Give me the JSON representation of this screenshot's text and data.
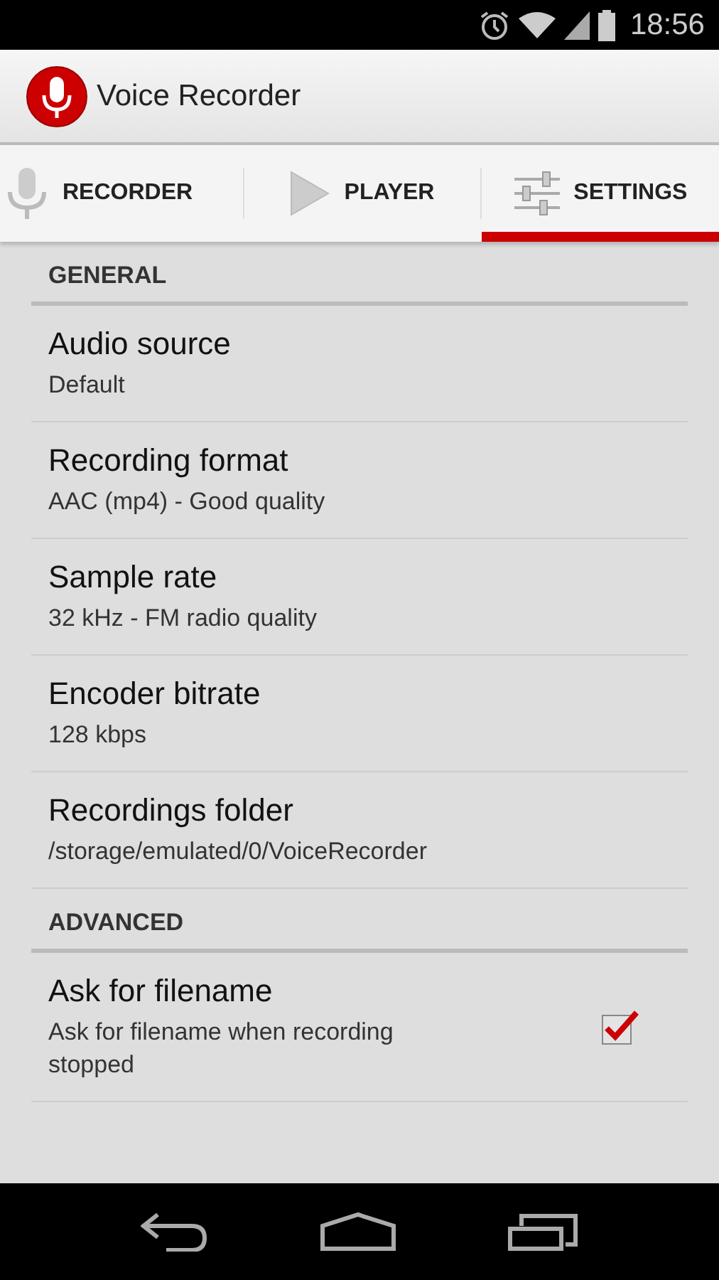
{
  "status_bar": {
    "time": "18:56"
  },
  "app_bar": {
    "title": "Voice Recorder"
  },
  "tabs": [
    {
      "label": "RECORDER",
      "selected": false
    },
    {
      "label": "PLAYER",
      "selected": false
    },
    {
      "label": "SETTINGS",
      "selected": true
    }
  ],
  "sections": [
    {
      "title": "GENERAL",
      "items": [
        {
          "kind": "pref",
          "title": "Audio source",
          "summary": "Default"
        },
        {
          "kind": "pref",
          "title": "Recording format",
          "summary": "AAC (mp4) - Good quality"
        },
        {
          "kind": "pref",
          "title": "Sample rate",
          "summary": "32 kHz - FM radio quality"
        },
        {
          "kind": "pref",
          "title": "Encoder bitrate",
          "summary": "128 kbps"
        },
        {
          "kind": "pref",
          "title": "Recordings folder",
          "summary": "/storage/emulated/0/VoiceRecorder"
        }
      ]
    },
    {
      "title": "ADVANCED",
      "items": [
        {
          "kind": "checkbox",
          "title": "Ask for filename",
          "summary": "Ask for filename when recording stopped",
          "checked": true
        }
      ]
    }
  ]
}
